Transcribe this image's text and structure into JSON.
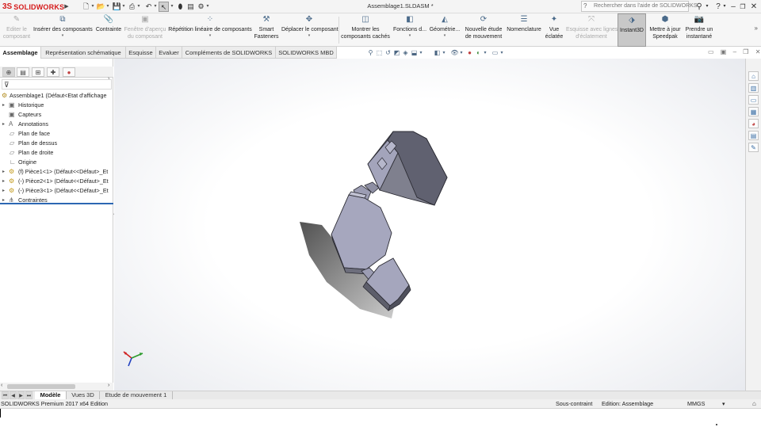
{
  "app": {
    "logo_text": "SOLIDWORKS",
    "logo_glyph": "3S",
    "document_title": "Assemblage1.SLDASM *"
  },
  "quick_access": {
    "icons": [
      "new-document-icon",
      "open-icon",
      "save-icon",
      "print-icon",
      "undo-icon",
      "select-icon",
      "rebuild-icon",
      "file-properties-icon",
      "options-icon"
    ]
  },
  "search": {
    "placeholder": "Rechercher dans l'aide de SOLIDWORKS"
  },
  "ribbon": {
    "items": [
      {
        "label1": "Editer le",
        "label2": "composant",
        "disabled": true
      },
      {
        "label1": "Insérer des composants",
        "label2": "",
        "disabled": false
      },
      {
        "label1": "Contrainte",
        "label2": "",
        "disabled": false
      },
      {
        "label1": "Fenêtre d'aperçu",
        "label2": "du composant",
        "disabled": true
      },
      {
        "label1": "Répétition linéaire de composants",
        "label2": "",
        "disabled": false
      },
      {
        "label1": "Smart",
        "label2": "Fasteners",
        "disabled": false
      },
      {
        "label1": "Déplacer le composant",
        "label2": "",
        "disabled": false
      },
      {
        "label1": "Montrer les",
        "label2": "composants cachés",
        "disabled": false
      },
      {
        "label1": "Fonctions d...",
        "label2": "",
        "disabled": false
      },
      {
        "label1": "Géométrie...",
        "label2": "",
        "disabled": false
      },
      {
        "label1": "Nouvelle étude",
        "label2": "de mouvement",
        "disabled": false
      },
      {
        "label1": "Nomenclature",
        "label2": "",
        "disabled": false
      },
      {
        "label1": "Vue",
        "label2": "éclatée",
        "disabled": false
      },
      {
        "label1": "Esquisse avec lignes",
        "label2": "d'éclatement",
        "disabled": true
      },
      {
        "label1": "Instant3D",
        "label2": "",
        "disabled": false,
        "active": true
      },
      {
        "label1": "Mettre à jour",
        "label2": "Speedpak",
        "disabled": false
      },
      {
        "label1": "Prendre un",
        "label2": "instantané",
        "disabled": false
      }
    ]
  },
  "command_tabs": [
    "Assemblage",
    "Représentation schématique",
    "Esquisse",
    "Evaluer",
    "Compléments de SOLIDWORKS",
    "SOLIDWORKS MBD"
  ],
  "feature_tree": {
    "root": "Assemblage1  (Défaut<Etat d'affichage",
    "items": [
      {
        "label": "Historique",
        "expandable": true
      },
      {
        "label": "Capteurs",
        "expandable": false
      },
      {
        "label": "Annotations",
        "expandable": true
      },
      {
        "label": "Plan de face",
        "expandable": false
      },
      {
        "label": "Plan de dessus",
        "expandable": false
      },
      {
        "label": "Plan de droite",
        "expandable": false
      },
      {
        "label": "Origine",
        "expandable": false
      },
      {
        "label": "(f) Pièce1<1> (Défaut<<Défaut>_Et",
        "expandable": true
      },
      {
        "label": "(-) Pièce2<1> (Défaut<<Défaut>_Et",
        "expandable": true
      },
      {
        "label": "(-) Pièce3<1> (Défaut<<Défaut>_Et",
        "expandable": true
      },
      {
        "label": "Contraintes",
        "expandable": true
      }
    ]
  },
  "bottom_tabs": [
    "Modèle",
    "Vues 3D",
    "Etude de mouvement 1"
  ],
  "status_bar": {
    "product": "SOLIDWORKS Premium 2017 x64 Edition",
    "constraint_state": "Sous-contraint",
    "editing": "Edition: Assemblage",
    "units": "MMGS",
    "units_dropdown": "▾"
  },
  "colors": {
    "brand_red": "#d51a1a",
    "part_face_light": "#a8a9c2",
    "part_face_dark": "#62636f",
    "part_edge": "#2b2b33",
    "selection_blue": "#2c67b3"
  }
}
